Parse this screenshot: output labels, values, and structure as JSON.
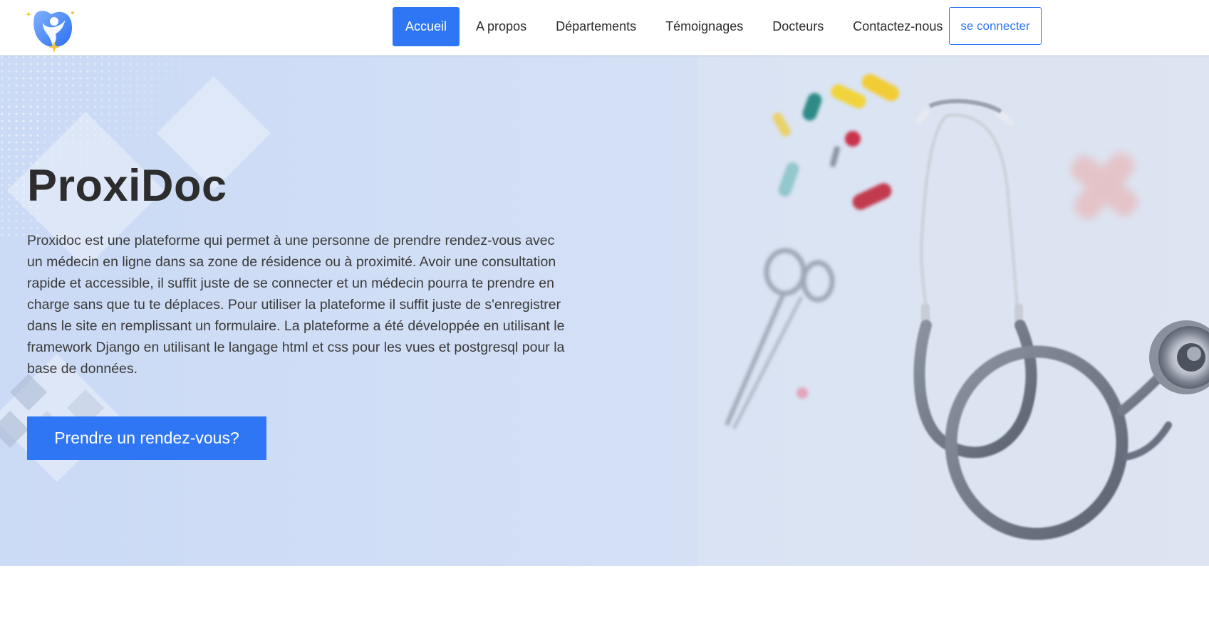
{
  "brand": {
    "logo_icon": "person-with-heart-logo-icon"
  },
  "nav": {
    "items": [
      {
        "label": "Accueil",
        "active": true
      },
      {
        "label": "A propos"
      },
      {
        "label": "Départements"
      },
      {
        "label": "Témoignages"
      },
      {
        "label": "Docteurs"
      },
      {
        "label": "Contactez-nous"
      }
    ],
    "login_label": "se connecter"
  },
  "hero": {
    "title": "ProxiDoc",
    "description": "Proxidoc est une plateforme qui permet à une personne de prendre rendez-vous avec un médecin en ligne dans sa zone de résidence ou à proximité. Avoir une consultation rapide et accessible, il suffit juste de se connecter et un médecin pourra te prendre en charge sans que tu te déplaces. Pour utiliser la plateforme il suffit juste de s'enregistrer dans le site en remplissant un formulaire. La plateforme a été développée en utilisant le framework Django en utilisant le langage html et css pour les vues et postgresql pour la base de données.",
    "cta_label": "Prendre un rendez-vous?",
    "image_subject": "stethoscope-pills-scissors-photo"
  },
  "colors": {
    "primary": "#2f76f5",
    "hero_background": "#cbdaf5",
    "title": "#2d2d2d",
    "text": "#3a3a3a"
  }
}
